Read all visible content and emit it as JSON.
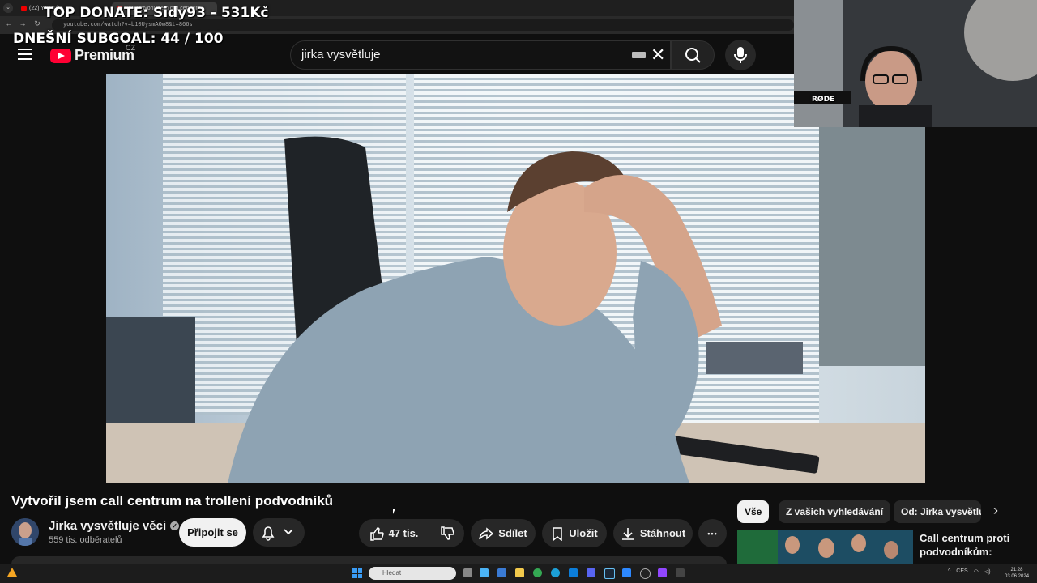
{
  "browser": {
    "tabs": [
      {
        "label": "(22) YouTube",
        "active": false
      },
      {
        "label": "(22) Vytvořil jsem call centrum",
        "active": true
      }
    ],
    "url": "youtube.com/watch?v=b10UysmAOw8&t=866s"
  },
  "overlay": {
    "top_donate": "TOP DONATE: Sidy93 - 531Kč",
    "subgoal": "DNEŠNÍ SUBGOAL:  44 / 100",
    "mic_label": "RØDE"
  },
  "header": {
    "logo": "Premium",
    "country": "CZ",
    "search_value": "jirka vysvětluje"
  },
  "video": {
    "title": "Vytvořil jsem call centrum na trollení podvodníků",
    "channel": "Jirka vysvětluje věci",
    "verified_mark": "✓",
    "subscribers": "559 tis. odběratelů",
    "join": "Připojit se",
    "likes": "47 tis.",
    "share": "Sdílet",
    "save": "Uložit",
    "download": "Stáhnout",
    "more": "•••"
  },
  "chips": {
    "all": "Vše",
    "search": "Z vašich vyhledávání",
    "from": "Od: Jirka vysvětluje věci",
    "next": "›"
  },
  "recommendation": {
    "title": "Call centrum proti podvodníkům: BONUSY"
  },
  "taskbar": {
    "search_placeholder": "Hledat",
    "tray": [
      "^",
      "CES"
    ],
    "time": "21:28",
    "date": "03.06.2024"
  },
  "colors": {
    "accent": "#ff0033",
    "chip_active": "#f1f1f1",
    "background": "#0f0f0f"
  }
}
